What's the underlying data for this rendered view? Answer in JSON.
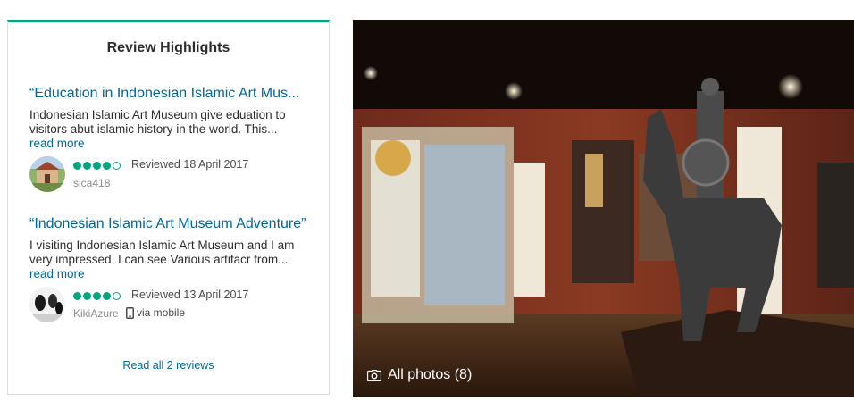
{
  "highlights": {
    "title": "Review Highlights",
    "reviews": [
      {
        "title": "“Education in Indonesian Islamic Art Mus...",
        "body": "Indonesian Islamic Art Museum give eduation to visitors abut islamic history in the world. This...",
        "read_more": "read more",
        "rating": 4,
        "date_text": "Reviewed 18 April 2017",
        "user": "sica418"
      },
      {
        "title": "“Indonesian Islamic Art Museum Adventure”",
        "body": "I visiting Indonesian Islamic Art Museum and I am very impressed. I can see Various artifacr from...",
        "read_more": "read more",
        "rating": 4,
        "date_text": "Reviewed 13 April 2017",
        "user": "KikiAzure",
        "device": "via mobile"
      }
    ],
    "read_all": "Read all 2 reviews"
  },
  "photo": {
    "label": "All photos (8)"
  },
  "colors": {
    "accent": "#00a680",
    "link": "#006699"
  }
}
